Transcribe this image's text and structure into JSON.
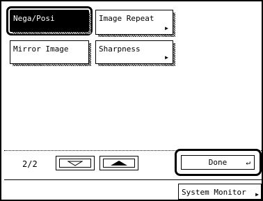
{
  "options": {
    "nega_posi": "Nega/Posi",
    "image_repeat": "Image Repeat",
    "mirror_image": "Mirror Image",
    "sharpness": "Sharpness"
  },
  "pager": {
    "label": "2/2"
  },
  "actions": {
    "done": "Done",
    "system_monitor": "System Monitor"
  },
  "icons": {
    "submenu": "submenu-arrow-icon",
    "down": "scroll-down-icon",
    "up": "scroll-up-icon",
    "enter": "enter-icon"
  }
}
